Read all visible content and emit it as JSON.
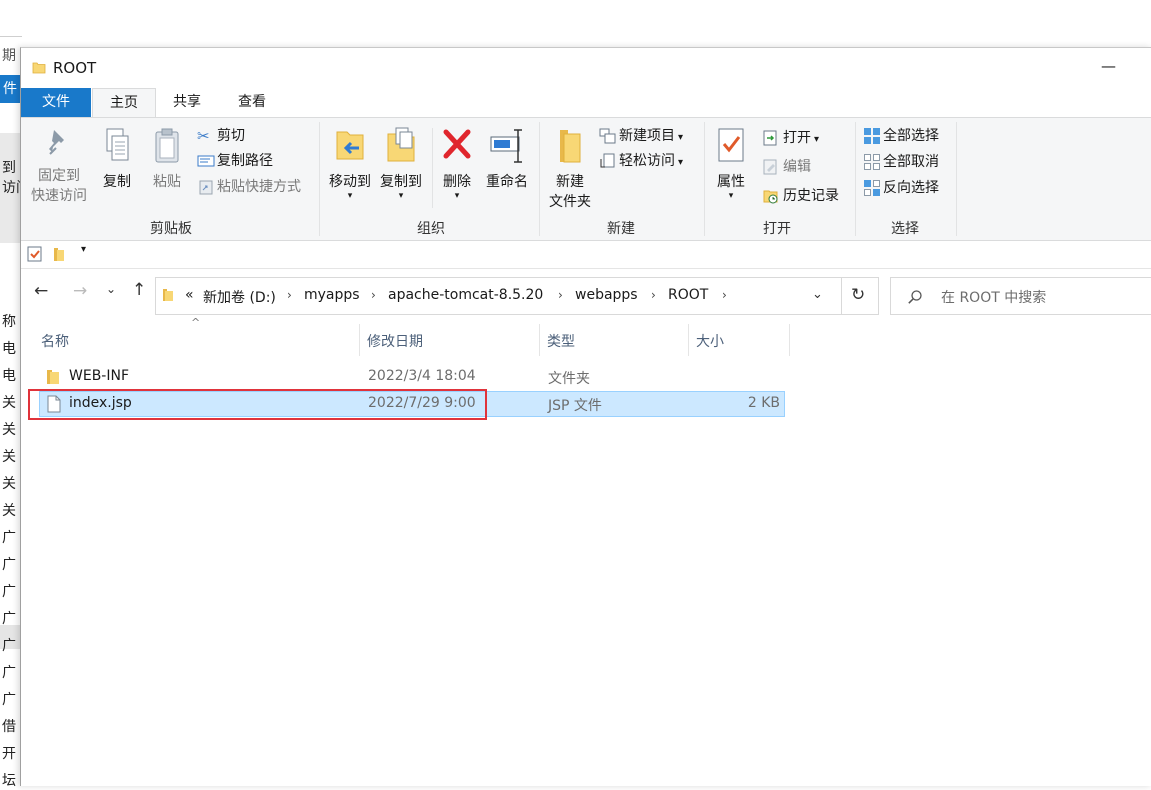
{
  "background_window": {
    "top_text": "期",
    "blue_text": "件",
    "side_texts": [
      "到",
      "访问"
    ],
    "list_items": [
      "称",
      "电",
      "电",
      "关",
      "关",
      "关",
      "关",
      "关",
      "广",
      "广",
      "广",
      "广",
      "广",
      "广",
      "广",
      "借",
      "开",
      "坛"
    ]
  },
  "window": {
    "title": "ROOT",
    "minimize_symbol": "—"
  },
  "ribbon_tabs": {
    "file": "文件",
    "home": "主页",
    "share": "共享",
    "view": "查看"
  },
  "ribbon": {
    "clipboard": {
      "pin": [
        "固定到",
        "快速访问"
      ],
      "copy": "复制",
      "paste": "粘贴",
      "cut": "剪切",
      "copy_path": "复制路径",
      "paste_shortcut": "粘贴快捷方式",
      "label": "剪贴板"
    },
    "organize": {
      "move_to": "移动到",
      "copy_to": "复制到",
      "delete": "删除",
      "rename": "重命名",
      "label": "组织"
    },
    "new": {
      "new_folder": [
        "新建",
        "文件夹"
      ],
      "new_item": "新建项目",
      "easy_access": "轻松访问",
      "label": "新建"
    },
    "open": {
      "properties": "属性",
      "open": "打开",
      "edit": "编辑",
      "history": "历史记录",
      "label": "打开"
    },
    "select": {
      "select_all": "全部选择",
      "select_none": "全部取消",
      "invert": "反向选择",
      "label": "选择"
    }
  },
  "address": {
    "overflow": "«",
    "crumbs": [
      "新加卷 (D:)",
      "myapps",
      "apache-tomcat-8.5.20",
      "webapps",
      "ROOT"
    ],
    "search_placeholder": "在 ROOT 中搜索"
  },
  "columns": {
    "name": "名称",
    "modified": "修改日期",
    "type": "类型",
    "size": "大小"
  },
  "files": [
    {
      "name": "WEB-INF",
      "modified": "2022/3/4 18:04",
      "type": "文件夹",
      "size": "",
      "kind": "folder-icon"
    },
    {
      "name": "index.jsp",
      "modified": "2022/7/29 9:00",
      "type": "JSP 文件",
      "size": "2 KB",
      "kind": "file-icon",
      "selected": true
    }
  ],
  "colors": {
    "accent": "#1979ca",
    "selection": "#cce8ff",
    "highlight_box": "#e0333b"
  }
}
